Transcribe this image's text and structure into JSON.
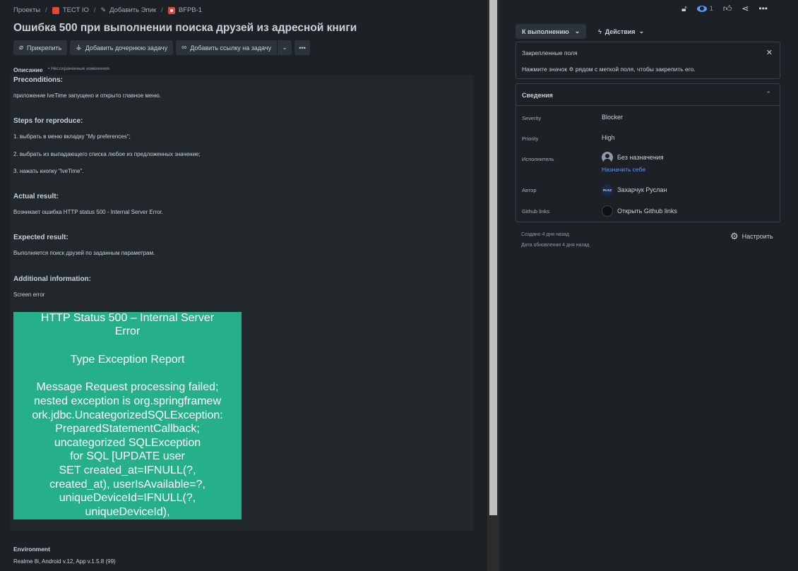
{
  "breadcrumb": {
    "projects": "Проекты",
    "project": "ТЕСТ IO",
    "add_epic": "Добавить Эпик",
    "issue_key": "BFPB-1"
  },
  "issue": {
    "title": "Ошибка 500 при выполнении поиска друзей из адресной книги"
  },
  "toolbar": {
    "attach": "Прикрепить",
    "add_child": "Добавить дочернюю задачу",
    "add_link": "Добавить ссылку на задачу",
    "more": "•••"
  },
  "description": {
    "label": "Описание",
    "unsaved": "• Несохраненные изменения",
    "preconditions_h": "Preconditions:",
    "preconditions": "приложение lveTime запущено и открыто главное меню.",
    "steps_h": "Steps for reproduce:",
    "step1": "1. выбрать в меню вкладку \"My preferences\";",
    "step2": "2. выбрать из выпадающего списка любое из предложенных значение;",
    "step3": "3. нажать кнопку \"lveTime\".",
    "actual_h": "Actual result:",
    "actual": "Возникает ошибка HTTP status 500 - Internal Server Error.",
    "expected_h": "Expected result:",
    "expected": "Выполняется поиск друзей по заданным параметрам.",
    "additional_h": "Additional information:",
    "additional": "Screen error"
  },
  "screenshot": {
    "line1": "HTTP Status 500 – Internal Server",
    "line2": "Error",
    "line3": "Type Exception Report",
    "line4": "Message Request processing failed;",
    "line5": "nested exception is org.springframew",
    "line6": "ork.jdbc.UncategorizedSQLException:",
    "line7": "PreparedStatementCallback;",
    "line8": "uncategorized SQLException",
    "line9": "for SQL [UPDATE user",
    "line10": "SET created_at=IFNULL(?,",
    "line11": "created_at), userIsAvailable=?,",
    "line12": "uniqueDeviceId=IFNULL(?,",
    "line13": "uniqueDeviceId),"
  },
  "environment": {
    "label": "Environment",
    "value": "Realme 8i, Android v.12, App v.1.5.8 (99)"
  },
  "sidebar": {
    "watch_count": "1",
    "status": "К выполнению",
    "actions": "Действия",
    "pinned_title": "Закрепленные поля",
    "pinned_text": "Нажмите значок ✡ рядом с меткой поля, чтобы закрепить его.",
    "details_title": "Сведения",
    "fields": {
      "severity_label": "Severity",
      "severity_value": "Blocker",
      "priority_label": "Priority",
      "priority_value": "High",
      "assignee_label": "Исполнитель",
      "assignee_value": "Без назначения",
      "assign_self": "Назначить себе",
      "author_label": "Автор",
      "author_value": "Захарчук Руслан",
      "author_initials": "RUSZ",
      "github_label": "Github links",
      "github_value": "Открыть Github links"
    },
    "created": "Создано 4 дня назад",
    "updated": "Дата обновления 4 дня назад",
    "configure": "Настроить"
  },
  "colors": {
    "background": "#1d2125",
    "editor": "#22272b",
    "screenshot_bg": "#26b089",
    "link": "#579dff",
    "project_icon": "#e2483d"
  }
}
